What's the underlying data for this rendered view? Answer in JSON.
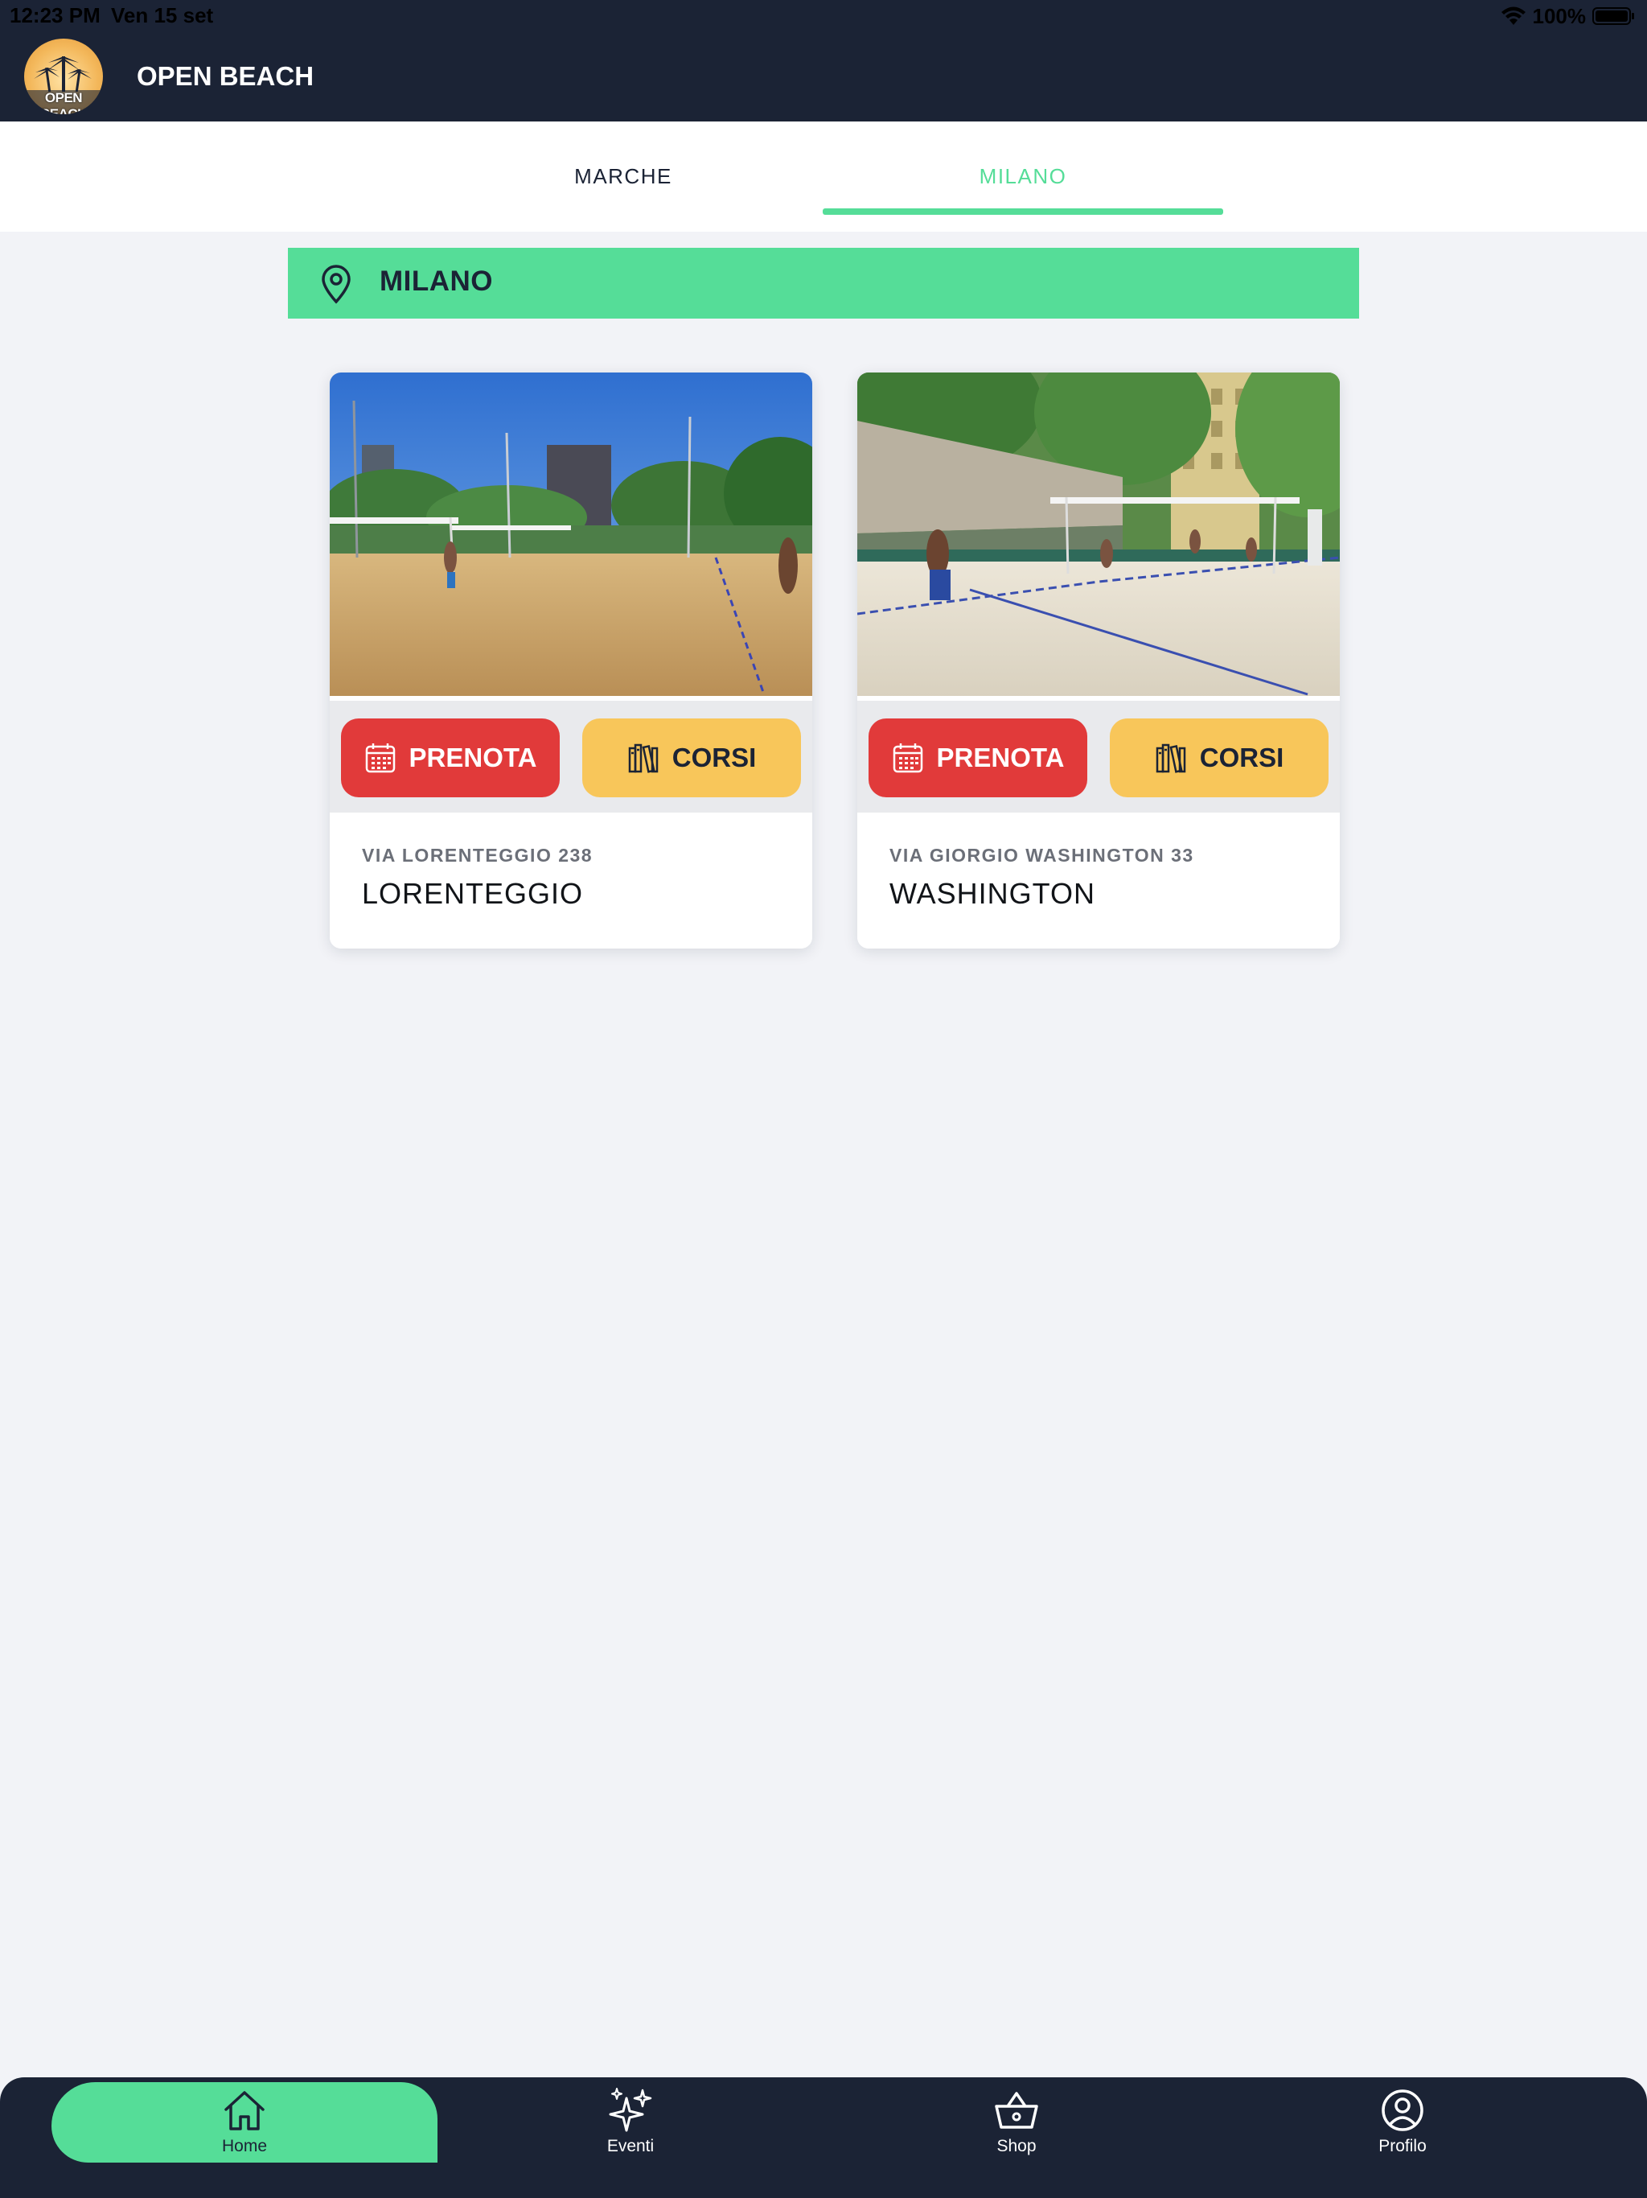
{
  "status_bar": {
    "time": "12:23 PM",
    "date": "Ven 15 set",
    "battery": "100%",
    "icons": [
      "wifi-icon",
      "battery-icon"
    ]
  },
  "header": {
    "logo_text": "OPEN BEACH",
    "title": "OPEN BEACH"
  },
  "tabs": [
    {
      "label": "MARCHE",
      "active": false
    },
    {
      "label": "MILANO",
      "active": true
    }
  ],
  "location": {
    "icon": "map-pin-icon",
    "title": "MILANO"
  },
  "venues": [
    {
      "address": "VIA LORENTEGGIO 238",
      "name": "LORENTEGGIO",
      "book_label": "PRENOTA",
      "courses_label": "CORSI"
    },
    {
      "address": "VIA GIORGIO WASHINGTON 33",
      "name": "WASHINGTON",
      "book_label": "PRENOTA",
      "courses_label": "CORSI"
    }
  ],
  "bottom_nav": [
    {
      "label": "Home",
      "icon": "home-icon",
      "active": true
    },
    {
      "label": "Eventi",
      "icon": "sparkles-icon",
      "active": false
    },
    {
      "label": "Shop",
      "icon": "basket-icon",
      "active": false
    },
    {
      "label": "Profilo",
      "icon": "user-circle-icon",
      "active": false
    }
  ],
  "colors": {
    "header_bg": "#1b2335",
    "accent_green": "#55dd98",
    "book_red": "#e13a3a",
    "courses_yellow": "#f8c65a",
    "page_bg": "#f2f3f7"
  }
}
